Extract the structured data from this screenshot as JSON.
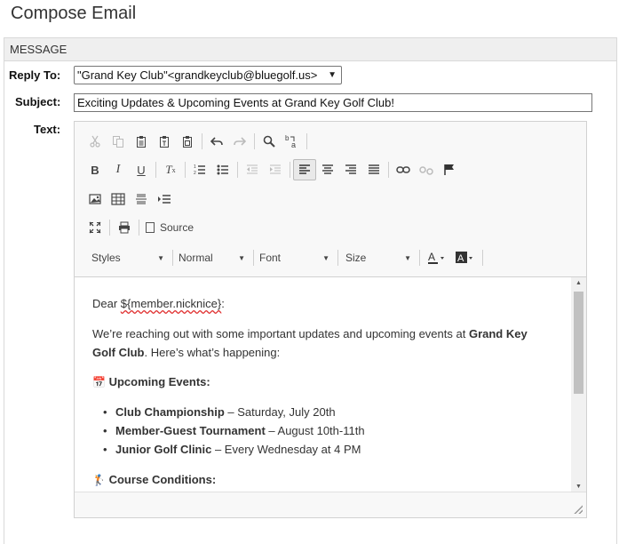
{
  "page": {
    "title": "Compose Email"
  },
  "panel": {
    "header": "MESSAGE"
  },
  "form": {
    "reply_to_label": "Reply To:",
    "reply_to_value": "\"Grand Key Club\"<grandkeyclub@bluegolf.us>",
    "subject_label": "Subject:",
    "subject_value": "Exciting Updates & Upcoming Events at Grand Key Golf Club!",
    "text_label": "Text:"
  },
  "toolbar": {
    "source_label": "Source",
    "styles_label": "Styles",
    "format_label": "Normal",
    "font_label": "Font",
    "size_label": "Size",
    "icons_row1": [
      "cut-icon",
      "copy-icon",
      "paste-icon",
      "paste-text-icon",
      "paste-word-icon",
      "undo-icon",
      "redo-icon",
      "find-icon",
      "replace-icon"
    ],
    "icons_row2": [
      "bold-icon",
      "italic-icon",
      "underline-icon",
      "remove-format-icon",
      "numbered-list-icon",
      "bulleted-list-icon",
      "outdent-icon",
      "indent-icon",
      "align-left-icon",
      "align-center-icon",
      "align-right-icon",
      "justify-icon",
      "link-icon",
      "unlink-icon",
      "anchor-icon"
    ],
    "icons_row3": [
      "image-icon",
      "table-icon",
      "horizontal-line-icon",
      "page-break-icon"
    ],
    "icons_row4": [
      "maximize-icon",
      "print-icon"
    ]
  },
  "content": {
    "greeting_prefix": "Dear ",
    "greeting_var": "${member.nicknice}",
    "greeting_suffix": ":",
    "intro_text_1": "We’re reaching out with some important updates and upcoming events at ",
    "intro_bold_1": "Grand Key",
    "intro_bold_2": "Golf Club",
    "intro_text_2": ". Here’s what’s happening:",
    "events_emoji": "📅",
    "events_heading": "Upcoming Events:",
    "events": [
      {
        "name": "Club Championship",
        "detail": " – Saturday, July 20th"
      },
      {
        "name": "Member-Guest Tournament",
        "detail": " – August 10th-11th"
      },
      {
        "name": "Junior Golf Clinic",
        "detail": " – Every Wednesday at 4 PM"
      }
    ],
    "conditions_emoji": "🏌",
    "conditions_heading": "Course Conditions:"
  },
  "colors": {
    "accent": "#1a73e8",
    "spell_error": "#e03030"
  }
}
